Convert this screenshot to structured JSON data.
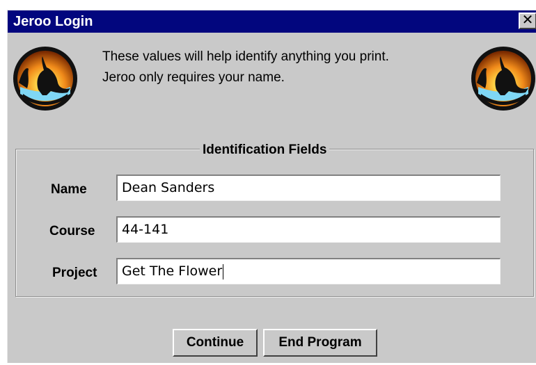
{
  "window": {
    "title": "Jeroo Login",
    "close_glyph": "✕"
  },
  "intro": {
    "line1": "These values will help identify anything you print.",
    "line2": "Jeroo only requires your name."
  },
  "group": {
    "title": "Identification Fields"
  },
  "fields": {
    "name": {
      "label": "Name",
      "value": "Dean Sanders"
    },
    "course": {
      "label": "Course",
      "value": "44-141"
    },
    "project": {
      "label": "Project",
      "value": "Get The Flower"
    }
  },
  "buttons": {
    "continue_label": "Continue",
    "end_label": "End Program"
  },
  "icons": {
    "logo": "kangaroo-sunset-logo-icon",
    "close": "close-icon"
  },
  "colors": {
    "titlebar": "#02067e",
    "window_bg": "#c9c9c9"
  }
}
